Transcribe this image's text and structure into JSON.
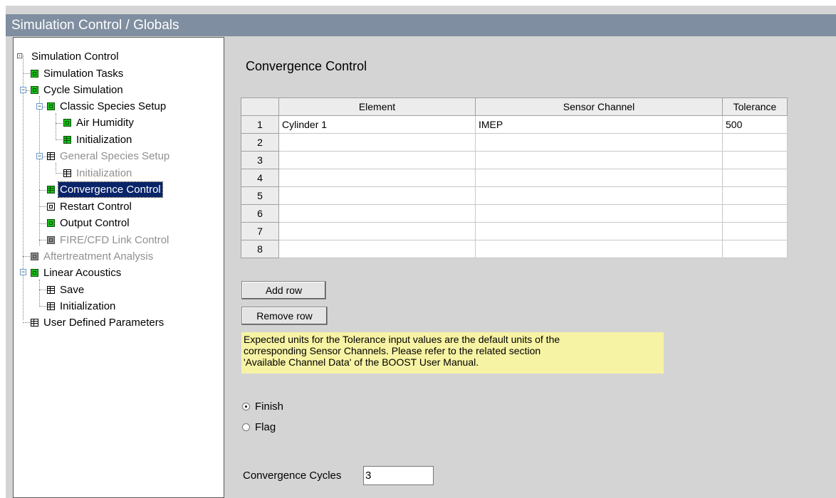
{
  "window": {
    "title": "Simulation Control / Globals"
  },
  "tree": {
    "items": [
      {
        "label": "Simulation Control"
      },
      {
        "label": "Simulation Tasks"
      },
      {
        "label": "Cycle Simulation"
      },
      {
        "label": "Classic Species Setup"
      },
      {
        "label": "Air Humidity"
      },
      {
        "label": "Initialization"
      },
      {
        "label": "General Species Setup"
      },
      {
        "label": "Initialization"
      },
      {
        "label": "Convergence Control"
      },
      {
        "label": "Restart Control"
      },
      {
        "label": "Output Control"
      },
      {
        "label": "FIRE/CFD Link Control"
      },
      {
        "label": "Aftertreatment Analysis"
      },
      {
        "label": "Linear Acoustics"
      },
      {
        "label": "Save"
      },
      {
        "label": "Initialization"
      },
      {
        "label": "User Defined Parameters"
      }
    ]
  },
  "main": {
    "heading": "Convergence Control",
    "table": {
      "headers": [
        "",
        "Element",
        "Sensor Channel",
        "Tolerance"
      ],
      "rows": [
        {
          "num": "1",
          "element": "Cylinder 1",
          "channel": "IMEP",
          "tolerance": "500"
        },
        {
          "num": "2",
          "element": "",
          "channel": "",
          "tolerance": ""
        },
        {
          "num": "3",
          "element": "",
          "channel": "",
          "tolerance": ""
        },
        {
          "num": "4",
          "element": "",
          "channel": "",
          "tolerance": ""
        },
        {
          "num": "5",
          "element": "",
          "channel": "",
          "tolerance": ""
        },
        {
          "num": "6",
          "element": "",
          "channel": "",
          "tolerance": ""
        },
        {
          "num": "7",
          "element": "",
          "channel": "",
          "tolerance": ""
        },
        {
          "num": "8",
          "element": "",
          "channel": "",
          "tolerance": ""
        }
      ]
    },
    "add_row_label": "Add row",
    "remove_row_label": "Remove row",
    "note_lines": [
      "Expected units for the Tolerance input values are the default units of the",
      "corresponding Sensor Channels. Please refer to the related section",
      "'Available Channel Data' of the BOOST User Manual."
    ],
    "radio_finish": "Finish",
    "radio_flag": "Flag",
    "selected_radio": "Finish",
    "convergence_cycles_label": "Convergence Cycles",
    "convergence_cycles_value": "3"
  },
  "colors": {
    "titlebar": "#7f8ea0",
    "panel": "#d4d4d4",
    "note_bg": "#f7f3a4",
    "selection": "#0a246a",
    "tree_icon_green": "#17c117"
  }
}
